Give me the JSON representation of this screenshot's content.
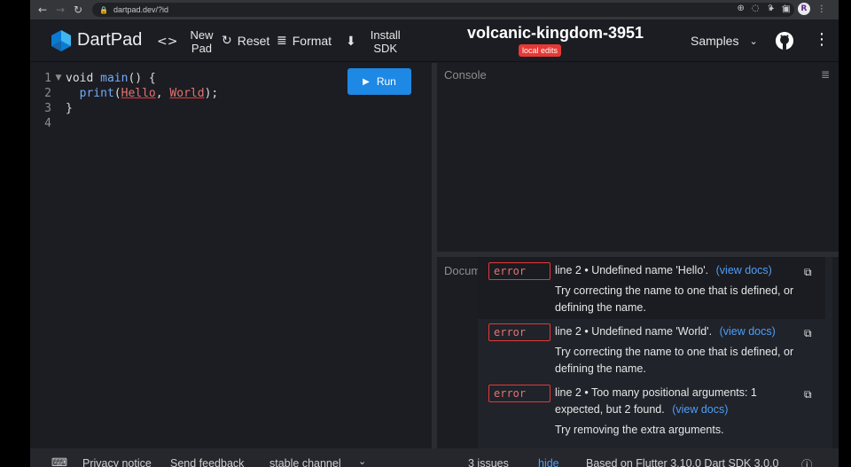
{
  "browser": {
    "url": "dartpad.dev/?id",
    "back_icon": "arrow-left-icon",
    "forward_icon": "arrow-right-icon",
    "reload_icon": "reload-icon",
    "profile_initial": "R"
  },
  "header": {
    "brand": "DartPad",
    "new_pad_line1": "New",
    "new_pad_line2": "Pad",
    "reset": "Reset",
    "format": "Format",
    "install_line1": "Install",
    "install_line2": "SDK",
    "pad_title": "volcanic-kingdom-3951",
    "badge": "local edits",
    "samples": "Samples"
  },
  "editor": {
    "run_label": "Run",
    "lines": [
      {
        "num": "1",
        "parts": [
          "void ",
          "main",
          "() {"
        ]
      },
      {
        "num": "2",
        "parts": [
          "  ",
          "print",
          "(",
          "Hello",
          ", ",
          "World",
          ");"
        ]
      },
      {
        "num": "3",
        "parts": [
          "}"
        ]
      },
      {
        "num": "4",
        "parts": [
          ""
        ]
      }
    ]
  },
  "console": {
    "label": "Console"
  },
  "docs": {
    "label": "Docum"
  },
  "issues": [
    {
      "severity": "error",
      "message": "line 2 • Undefined name 'Hello'.",
      "link": "(view docs)",
      "correction": "Try correcting the name to one that is defined, or defining the name."
    },
    {
      "severity": "error",
      "message": "line 2 • Undefined name 'World'.",
      "link": "(view docs)",
      "correction": "Try correcting the name to one that is defined, or defining the name."
    },
    {
      "severity": "error",
      "message": "line 2 • Too many positional arguments: 1 expected, but 2 found.",
      "link": "(view docs)",
      "correction": "Try removing the extra arguments."
    }
  ],
  "status": {
    "privacy": "Privacy notice",
    "feedback": "Send feedback",
    "channel": "stable channel",
    "issues_count": "3 issues",
    "hide": "hide",
    "version": "Based on Flutter 3.10.0 Dart SDK 3.0.0"
  },
  "colors": {
    "accent": "#1e88e5",
    "error": "#e53935",
    "link": "#4f9ef7",
    "background": "#1b1d22"
  }
}
